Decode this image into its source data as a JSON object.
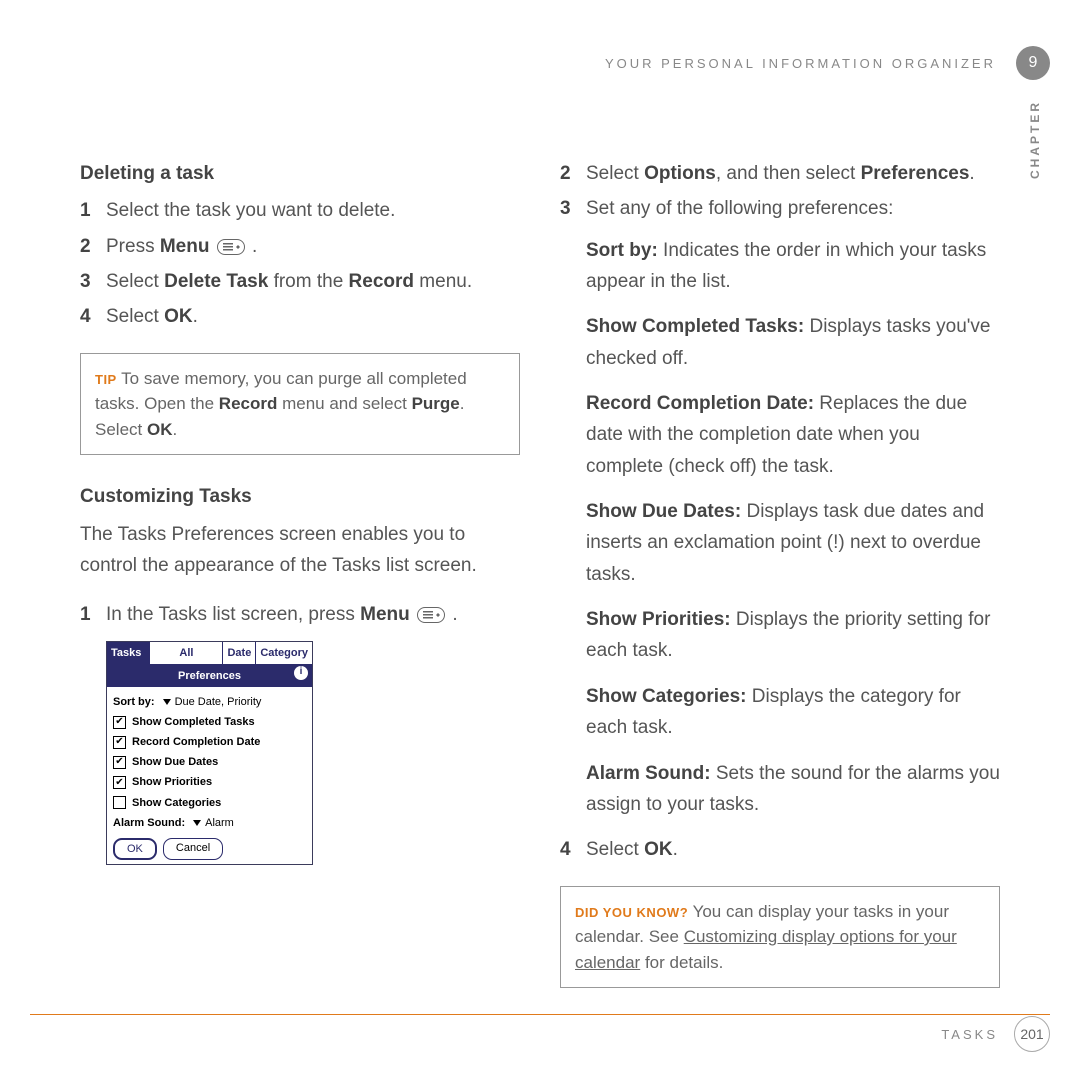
{
  "header": {
    "running_head": "YOUR PERSONAL INFORMATION ORGANIZER",
    "chapter_num": "9",
    "chapter_label": "CHAPTER"
  },
  "left": {
    "h1": "Deleting a task",
    "s1": "Select the task you want to delete.",
    "s2a": "Press ",
    "s2b": "Menu",
    "s2c": " .",
    "s3a": "Select ",
    "s3b": "Delete Task",
    "s3c": " from the ",
    "s3d": "Record",
    "s3e": " menu.",
    "s4a": "Select ",
    "s4b": "OK",
    "s4c": ".",
    "tip_label": "TIP",
    "tip_a": "To save memory, you can purge all completed tasks. Open the ",
    "tip_b": "Record",
    "tip_c": " menu and select ",
    "tip_d": "Purge",
    "tip_e": ". Select ",
    "tip_f": "OK",
    "tip_g": ".",
    "h2": "Customizing Tasks",
    "p2": "The Tasks Preferences screen enables you to control the appearance of the Tasks list screen.",
    "c1a": "In the Tasks list screen, press ",
    "c1b": "Menu",
    "c1c": " ."
  },
  "right": {
    "r2a": "Select ",
    "r2b": "Options",
    "r2c": ", and then select ",
    "r2d": "Preferences",
    "r2e": ".",
    "r3": "Set any of the following preferences:",
    "p_sort_h": "Sort by:",
    "p_sort_b": " Indicates the order in which your tasks appear in the list.",
    "p_sct_h": "Show Completed Tasks:",
    "p_sct_b": " Displays tasks you've checked off.",
    "p_rcd_h": "Record Completion Date:",
    "p_rcd_b": " Replaces the due date with the completion date when you complete (check off) the task.",
    "p_sdd_h": "Show Due Dates:",
    "p_sdd_b": " Displays task due dates and inserts an exclamation point (!) next to overdue tasks.",
    "p_sp_h": "Show Priorities:",
    "p_sp_b": " Displays the priority setting for each task.",
    "p_sc_h": "Show Categories:",
    "p_sc_b": " Displays the category for each task.",
    "p_as_h": "Alarm Sound:",
    "p_as_b": " Sets the sound for the alarms you assign to your tasks.",
    "r4a": "Select ",
    "r4b": "OK",
    "r4c": ".",
    "dyk_label": "DID YOU KNOW?",
    "dyk_a": "You can display your tasks in your calendar. See ",
    "dyk_link": "Customizing display options for your calendar",
    "dyk_b": " for details."
  },
  "palm": {
    "tab1": "Tasks",
    "tab2": "All",
    "tab3": "Date",
    "tab4": "Category",
    "title": "Preferences",
    "sortby_label": "Sort by:",
    "sortby_value": "Due Date, Priority",
    "opts": [
      {
        "checked": true,
        "label": "Show Completed Tasks"
      },
      {
        "checked": true,
        "label": "Record Completion Date"
      },
      {
        "checked": true,
        "label": "Show Due Dates"
      },
      {
        "checked": true,
        "label": "Show Priorities"
      },
      {
        "checked": false,
        "label": "Show Categories"
      }
    ],
    "alarm_label": "Alarm Sound:",
    "alarm_value": "Alarm",
    "ok": "OK",
    "cancel": "Cancel"
  },
  "footer": {
    "section": "TASKS",
    "page": "201"
  }
}
